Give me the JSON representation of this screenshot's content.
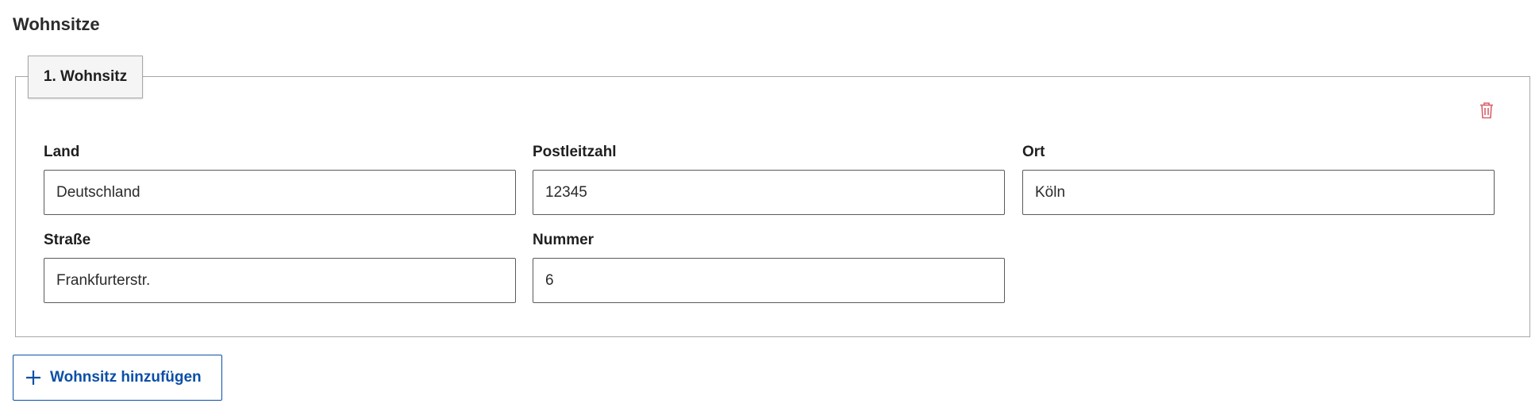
{
  "page": {
    "title": "Wohnsitze"
  },
  "residence": {
    "legend": "1. Wohnsitz",
    "fields": {
      "land": {
        "label": "Land",
        "value": "Deutschland"
      },
      "postleitzahl": {
        "label": "Postleitzahl",
        "value": "12345"
      },
      "ort": {
        "label": "Ort",
        "value": "Köln"
      },
      "strasse": {
        "label": "Straße",
        "value": "Frankfurterstr."
      },
      "nummer": {
        "label": "Nummer",
        "value": "6"
      }
    },
    "delete_icon": "trash-icon"
  },
  "actions": {
    "add_label": "Wohnsitz hinzufügen",
    "add_icon": "plus-icon"
  },
  "colors": {
    "accent": "#0b4fa8",
    "delete": "#d9606b",
    "border": "#a7a7a7"
  }
}
